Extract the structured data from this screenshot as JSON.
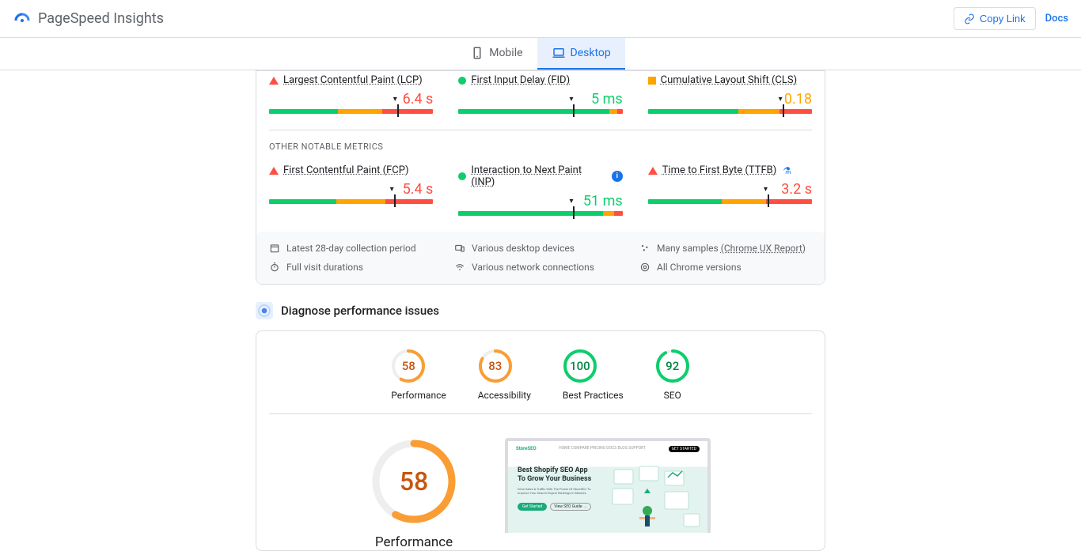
{
  "header": {
    "brand": "PageSpeed Insights",
    "copy": "Copy Link",
    "docs": "Docs"
  },
  "tabs": {
    "mobile": "Mobile",
    "desktop": "Desktop"
  },
  "metrics": {
    "lcp": {
      "name": "Largest Contentful Paint (LCP)",
      "value": "6.4 s"
    },
    "fid": {
      "name": "First Input Delay (FID)",
      "value": "5 ms"
    },
    "cls": {
      "name": "Cumulative Layout Shift (CLS)",
      "value": "0.18"
    }
  },
  "other_label": "OTHER NOTABLE METRICS",
  "other": {
    "fcp": {
      "name": "First Contentful Paint (FCP)",
      "value": "5.4 s"
    },
    "inp": {
      "name": "Interaction to Next Paint (INP)",
      "value": "51 ms"
    },
    "ttfb": {
      "name": "Time to First Byte (TTFB)",
      "value": "3.2 s"
    }
  },
  "footnotes": {
    "period": "Latest 28-day collection period",
    "devices": "Various desktop devices",
    "samples_prefix": "Many samples ",
    "samples_link": "(Chrome UX Report)",
    "durations": "Full visit durations",
    "network": "Various network connections",
    "versions": "All Chrome versions"
  },
  "diag": {
    "title": "Diagnose performance issues"
  },
  "gauges": {
    "perf": {
      "score": "58",
      "label": "Performance"
    },
    "a11y": {
      "score": "83",
      "label": "Accessibility"
    },
    "bp": {
      "score": "100",
      "label": "Best Practices"
    },
    "seo": {
      "score": "92",
      "label": "SEO"
    }
  },
  "detail": {
    "score": "58",
    "label": "Performance"
  },
  "screenshot": {
    "logo": "StoreSEO",
    "nav": "HOME   COMPARE   PRICING   DOCS   BLOG   SUPPORT",
    "cta_nav": "GET STARTED",
    "headline1": "Best Shopify SEO App",
    "headline2": "To Grow Your Business",
    "sub": "Drive Sales & Traffic With The Power Of StoreSEO To Improve Your Search Engine Rankings In Minutes",
    "cta1": "Get Started",
    "cta2": "View SEO Guide →"
  }
}
